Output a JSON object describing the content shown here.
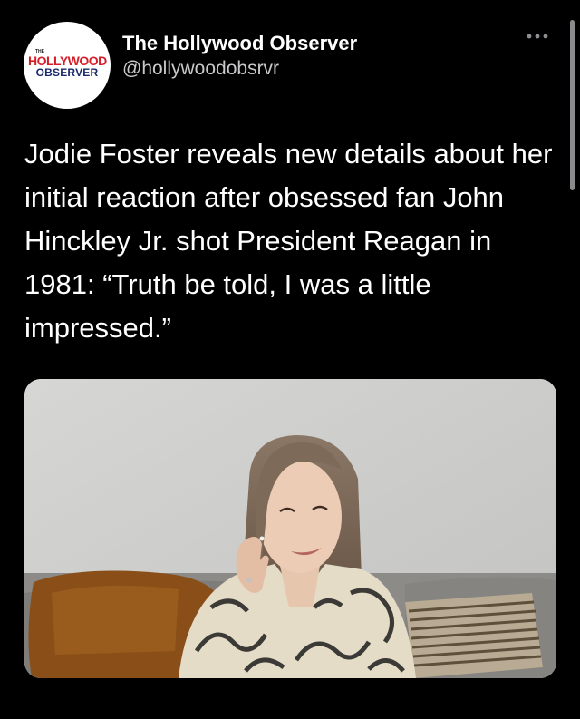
{
  "account": {
    "display_name": "The Hollywood Observer",
    "handle": "@hollywoodobsrvr",
    "avatar_logo": {
      "line1": "THE",
      "line2": "HOLLYWOOD",
      "line3": "OBSERVER"
    }
  },
  "tweet": {
    "text": "Jodie Foster reveals new details about her initial reaction after obsessed fan John Hinckley Jr. shot President Reagan in 1981: “Truth be told, I was a little impressed.”"
  },
  "icons": {
    "more": "more-options-icon"
  },
  "colors": {
    "background": "#000000",
    "text_primary": "#ffffff",
    "text_secondary": "#c9c9cb",
    "logo_red": "#d61e28",
    "logo_navy": "#1b2b6b"
  }
}
